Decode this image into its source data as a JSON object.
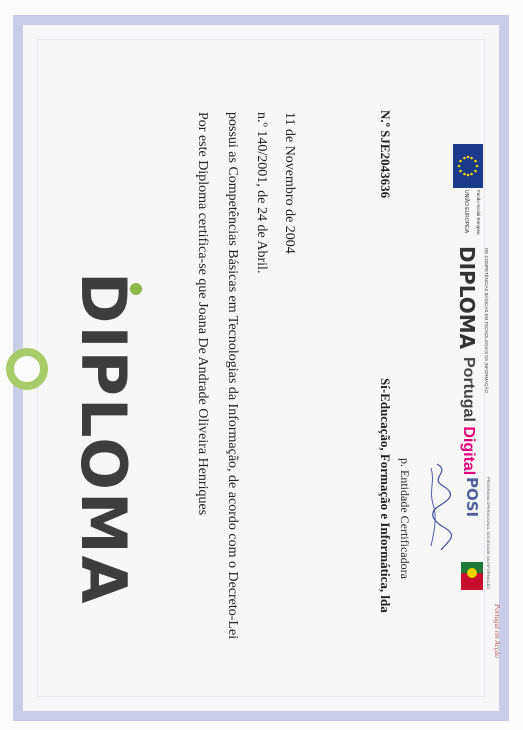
{
  "diploma": {
    "title": "DIPLOMA",
    "lines": [
      "Por este Diploma certifica-se que Joana De Andrade Oliveira Henriques",
      "possui as Competências Básicas em Tecnologias da Informação, de acordo com o Decreto-Lei",
      "n.º 140/2001, de 24 de Abril.",
      "11 de Novembro de 2004"
    ],
    "serial": "N.º SJE2043636",
    "company": "Sí-Educação, Formação e Informática, lda",
    "entity": "p. Entidade Certificadora"
  },
  "logos": {
    "eu_label": "UNIÃO EUROPEIA",
    "eu_sub": "Fundo Social Europeu",
    "diploma_logo": "DIPLOMA",
    "diploma_logo_sub": "DE COMPETÊNCIAS BÁSICAS EM TECNOLOGIAS DA INFORMAÇÃO",
    "portugal_digital": "Portugal Digital",
    "posi": "POSI",
    "posi_sub": "PROGRAMA OPERACIONAL SOCIEDADE DA INFORMAÇÃO",
    "portugal_em_accao": "Portugal em Acção"
  },
  "colors": {
    "frame": "#c9cde8",
    "ring": "#a8cb6a",
    "accent_green": "#8cb84a",
    "eu_blue": "#1c3a8a"
  }
}
